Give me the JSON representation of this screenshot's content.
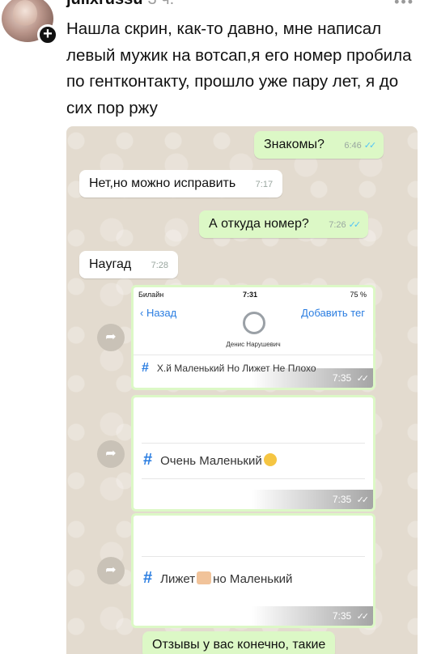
{
  "post": {
    "username": "julixrussu",
    "time": "3 ч.",
    "more": "•••",
    "text": "Нашла скрин, как-то давно, мне написал левый мужик на вотсап,я его номер пробила по гентконтакту, прошло уже пару лет, я до сих пор ржу"
  },
  "chat": {
    "messages": [
      {
        "dir": "out",
        "text": "Знакомы?",
        "time": "6:46",
        "ticks": "✓✓"
      },
      {
        "dir": "in",
        "text": "Нет,но можно исправить",
        "time": "7:17"
      },
      {
        "dir": "out",
        "text": "А откуда номер?",
        "time": "7:26",
        "ticks": "✓✓"
      },
      {
        "dir": "in",
        "text": "Нaугад",
        "time": "7:28"
      }
    ],
    "forward_icon": "share-icon",
    "cards": [
      {
        "status_left": "Билайн",
        "status_center": "7:31",
        "status_right": "75 %",
        "back_label": "Назад",
        "add_tag_label": "Добавить тег",
        "contact_name": "Денис Нарушевич",
        "hash": "#",
        "tag": "Х.й Маленький Но Лижет Не Плохо",
        "time": "7:35",
        "ticks": "✓✓"
      },
      {
        "hash": "#",
        "tag": "Очень Маленький",
        "time": "7:35",
        "ticks": "✓✓"
      },
      {
        "hash": "#",
        "tag_a": "Лижет",
        "tag_b": "но Маленький",
        "time": "7:35",
        "ticks": "✓✓"
      }
    ],
    "last_out_text": "Отзывы у вас конечно, такие"
  }
}
